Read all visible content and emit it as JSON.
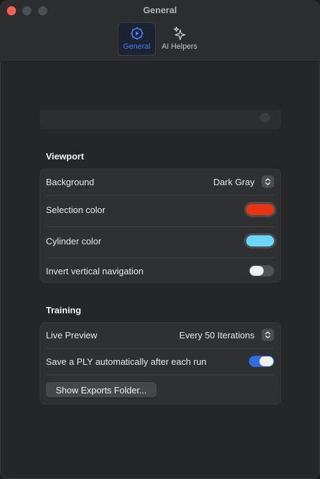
{
  "window": {
    "title": "General"
  },
  "toolbar": {
    "tabs": [
      {
        "label": "General",
        "icon": "gear-icon",
        "selected": true
      },
      {
        "label": "AI Helpers",
        "icon": "sparkles-icon",
        "selected": false
      }
    ]
  },
  "viewport": {
    "title": "Viewport",
    "background": {
      "label": "Background",
      "value": "Dark Gray"
    },
    "selection_color": {
      "label": "Selection color",
      "color": "#e83412"
    },
    "cylinder_color": {
      "label": "Cylinder color",
      "color": "#6fd6fb"
    },
    "invert_vertical": {
      "label": "Invert vertical navigation",
      "on": false
    }
  },
  "training": {
    "title": "Training",
    "live_preview": {
      "label": "Live Preview",
      "value": "Every 50 Iterations"
    },
    "save_ply": {
      "label": "Save a PLY automatically after each run",
      "on": true
    },
    "show_exports": "Show Exports Folder..."
  },
  "colors": {
    "accent": "#3d82f7",
    "close": "#ff5f57"
  }
}
